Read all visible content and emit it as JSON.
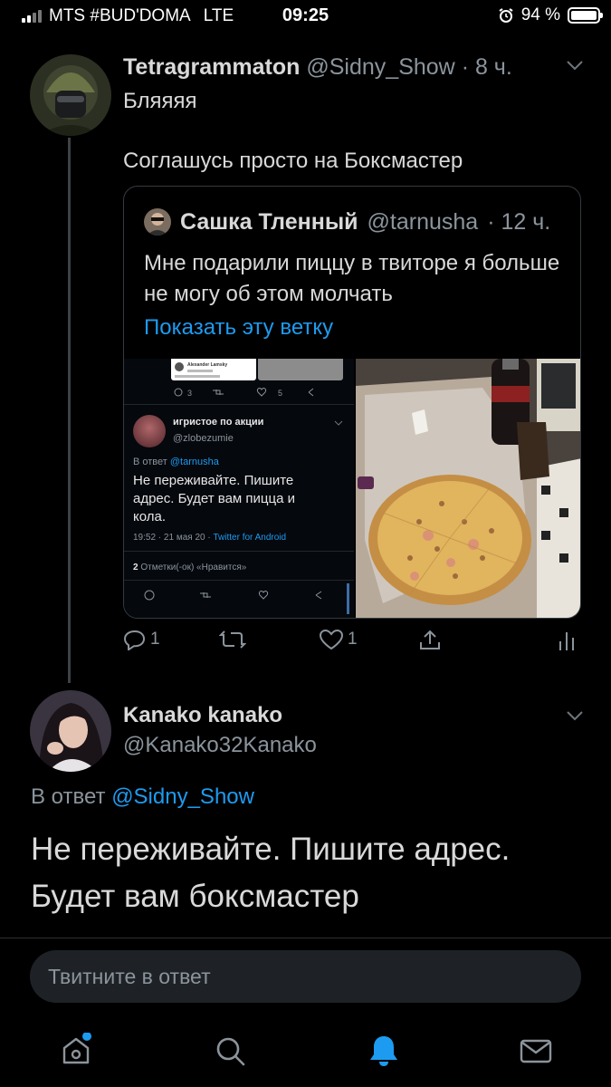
{
  "status_bar": {
    "carrier": "MTS #BUD'DOMA",
    "network": "LTE",
    "time": "09:25",
    "battery": "94 %"
  },
  "tweet": {
    "name": "Tetragrammaton",
    "handle": "@Sidny_Show",
    "time": "· 8 ч.",
    "text_line1": "Бляяяя",
    "text_line2": "Соглашусь просто на Боксмастер"
  },
  "quote": {
    "name": "Сашка Тленный",
    "handle": "@tarnusha",
    "time": "· 12 ч.",
    "text": "Мне подарили пиццу в твиторе я больше не могу об этом молчать",
    "show_thread": "Показать эту ветку",
    "screenshot": {
      "mini_name": "Alexander Lamsky",
      "mini_counts": [
        "3",
        "5"
      ],
      "name": "игристое по акции",
      "handle": "@zlobezumie",
      "reply_prefix": "В ответ",
      "reply_handle": "@tarnusha",
      "text": "Не переживайте. Пишите адрес. Будет вам пицца и кола.",
      "meta_time": "19:52 · 21 мая 20 ·",
      "meta_client": "Twitter for Android",
      "likes_count": "2",
      "likes_label": "Отметки(-ок) «Нравится»"
    }
  },
  "actions": {
    "reply_count": "1",
    "retweet_count": "",
    "like_count": "1"
  },
  "reply": {
    "name": "Kanako kanako",
    "handle": "@Kanako32Kanako",
    "reply_prefix": "В ответ",
    "reply_to": "@Sidny_Show",
    "text": "Не переживайте. Пишите адрес. Будет вам боксмастер"
  },
  "composer": {
    "placeholder": "Твитните в ответ"
  },
  "tabbar": {
    "items": [
      "home-icon",
      "search-icon",
      "notifications-icon",
      "messages-icon"
    ],
    "active_color": "#1d9bf0"
  }
}
